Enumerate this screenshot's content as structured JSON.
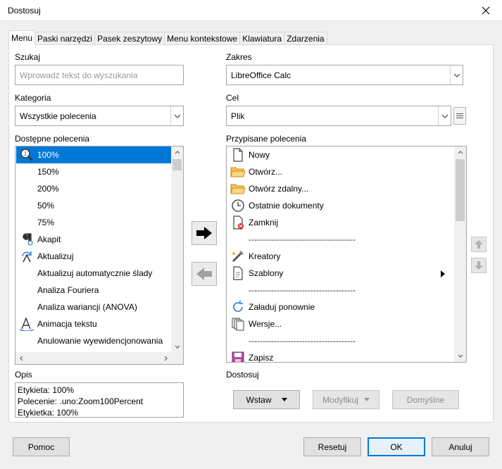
{
  "window": {
    "title": "Dostosuj"
  },
  "tabs": [
    "Menu",
    "Paski narzędzi",
    "Pasek zeszytowy",
    "Menu kontekstowe",
    "Klawiatura",
    "Zdarzenia"
  ],
  "search": {
    "label": "Szukaj",
    "placeholder": "Wprowadź tekst do wyszukania"
  },
  "category": {
    "label": "Kategoria",
    "value": "Wszystkie polecenia"
  },
  "scope": {
    "label": "Zakres",
    "value": "LibreOffice Calc"
  },
  "target": {
    "label": "Cel",
    "value": "Plik"
  },
  "available": {
    "label": "Dostępne polecenia",
    "items": [
      {
        "label": "100%",
        "icon": "zoom-100-icon",
        "selected": true
      },
      {
        "label": "150%",
        "icon": ""
      },
      {
        "label": "200%",
        "icon": ""
      },
      {
        "label": "50%",
        "icon": ""
      },
      {
        "label": "75%",
        "icon": ""
      },
      {
        "label": "Akapit",
        "icon": "paragraph-icon"
      },
      {
        "label": "Aktualizuj",
        "icon": "update-icon"
      },
      {
        "label": "Aktualizuj automatycznie ślady",
        "icon": ""
      },
      {
        "label": "Analiza Fouriera",
        "icon": ""
      },
      {
        "label": "Analiza wariancji (ANOVA)",
        "icon": ""
      },
      {
        "label": "Animacja tekstu",
        "icon": "text-animation-icon"
      },
      {
        "label": "Anulowanie wyewidencjonowania",
        "icon": ""
      }
    ]
  },
  "assigned": {
    "label": "Przypisane polecenia",
    "items": [
      {
        "label": "Nowy",
        "icon": "new-document-icon"
      },
      {
        "label": "Otwórz...",
        "icon": "open-folder-icon"
      },
      {
        "label": "Otwórz zdalny...",
        "icon": "open-remote-folder-icon"
      },
      {
        "label": "Ostatnie dokumenty",
        "icon": "recent-documents-icon"
      },
      {
        "label": "Zamknij",
        "icon": "close-document-icon"
      },
      {
        "label": "--------------------------------------",
        "icon": ""
      },
      {
        "label": "Kreatory",
        "icon": "wizard-icon"
      },
      {
        "label": "Szablony",
        "icon": "templates-icon",
        "submenu": true
      },
      {
        "label": "--------------------------------------",
        "icon": ""
      },
      {
        "label": "Załaduj ponownie",
        "icon": "reload-icon"
      },
      {
        "label": "Wersje...",
        "icon": "versions-icon"
      },
      {
        "label": "--------------------------------------",
        "icon": ""
      },
      {
        "label": "Zapisz",
        "icon": "save-icon"
      }
    ]
  },
  "description": {
    "label": "Opis",
    "lines": [
      "Etykieta: 100%",
      "Polecenie: .uno:Zoom100Percent",
      "Etykietka: 100%"
    ]
  },
  "customize": {
    "label": "Dostosuj",
    "insert": "Wstaw",
    "modify": "Modyfikuj",
    "defaults": "Domyślne"
  },
  "footer": {
    "help": "Pomoc",
    "reset": "Resetuj",
    "ok": "OK",
    "cancel": "Anuluj"
  }
}
